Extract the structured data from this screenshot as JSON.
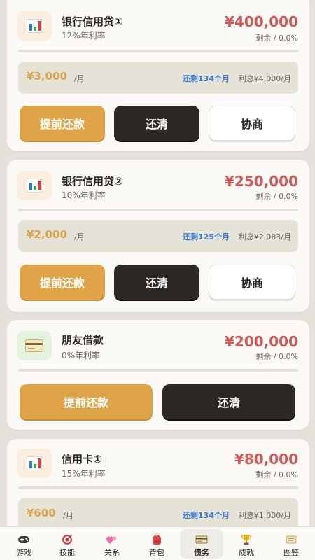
{
  "debts": [
    {
      "name": "银行信用贷①",
      "rate": "12%年利率",
      "amount": "¥400,000",
      "remain": "剩余 / 0.0%",
      "monthly": "¥3,000",
      "per": "/月",
      "months_left": "还剩134个月",
      "interest": "利息¥4,000/月",
      "buttons": {
        "prepay": "提前还款",
        "payoff": "还清",
        "negotiate": "协商"
      }
    },
    {
      "name": "银行信用贷②",
      "rate": "10%年利率",
      "amount": "¥250,000",
      "remain": "剩余 / 0.0%",
      "monthly": "¥2,000",
      "per": "/月",
      "months_left": "还剩125个月",
      "interest": "利息¥2,083/月",
      "buttons": {
        "prepay": "提前还款",
        "payoff": "还清",
        "negotiate": "协商"
      }
    },
    {
      "name": "朋友借款",
      "rate": "0%年利率",
      "amount": "¥200,000",
      "remain": "剩余 / 0.0%",
      "buttons": {
        "prepay": "提前还款",
        "payoff": "还清"
      }
    },
    {
      "name": "信用卡①",
      "rate": "15%年利率",
      "amount": "¥80,000",
      "remain": "剩余 / 0.0%",
      "monthly": "¥600",
      "per": "/月",
      "months_left": "还剩134个月",
      "interest": "利息¥1,000/月"
    }
  ],
  "nav": [
    {
      "label": "游戏",
      "icon": "gamepad-icon"
    },
    {
      "label": "技能",
      "icon": "target-icon"
    },
    {
      "label": "关系",
      "icon": "hearts-icon"
    },
    {
      "label": "背包",
      "icon": "backpack-icon"
    },
    {
      "label": "债务",
      "icon": "money-icon",
      "active": true
    },
    {
      "label": "成就",
      "icon": "trophy-icon"
    },
    {
      "label": "图鉴",
      "icon": "scroll-icon"
    }
  ],
  "colors": {
    "gold": "#dfa447",
    "dark": "#2c2826",
    "red": "#cf5a5a",
    "blue": "#3f7fcf"
  }
}
